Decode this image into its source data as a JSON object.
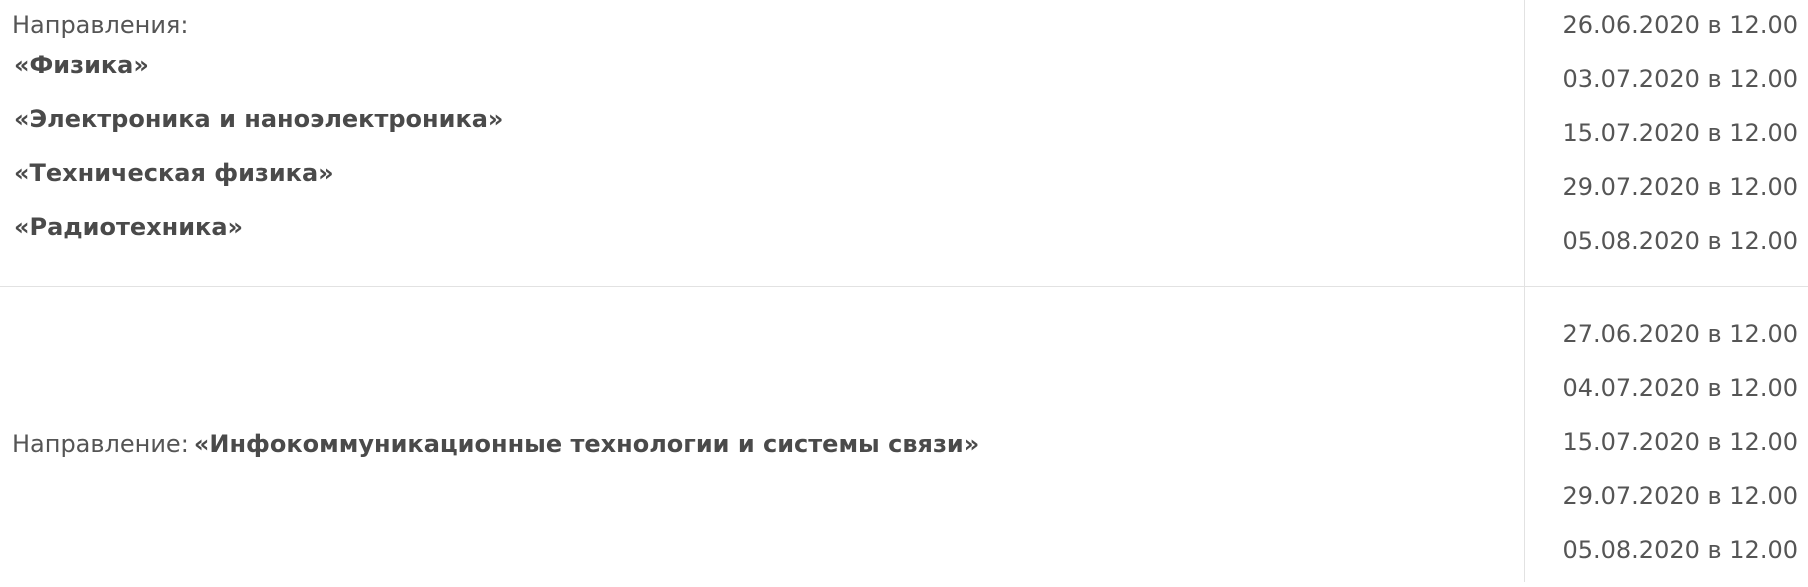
{
  "rows": [
    {
      "label": "Направления:",
      "directions": [
        "«Физика»",
        "«Электроника и наноэлектроника»",
        "«Техническая физика»",
        "«Радиотехника»"
      ],
      "dates": [
        "26.06.2020 в 12.00",
        "03.07.2020 в 12.00",
        "15.07.2020 в 12.00",
        "29.07.2020 в 12.00",
        "05.08.2020 в 12.00"
      ]
    },
    {
      "label": "Направление:",
      "direction": "«Инфокоммуникационные технологии и системы связи»",
      "dates": [
        "27.06.2020 в 12.00",
        "04.07.2020 в 12.00",
        "15.07.2020 в 12.00",
        "29.07.2020 в 12.00",
        "05.08.2020 в 12.00"
      ]
    }
  ]
}
